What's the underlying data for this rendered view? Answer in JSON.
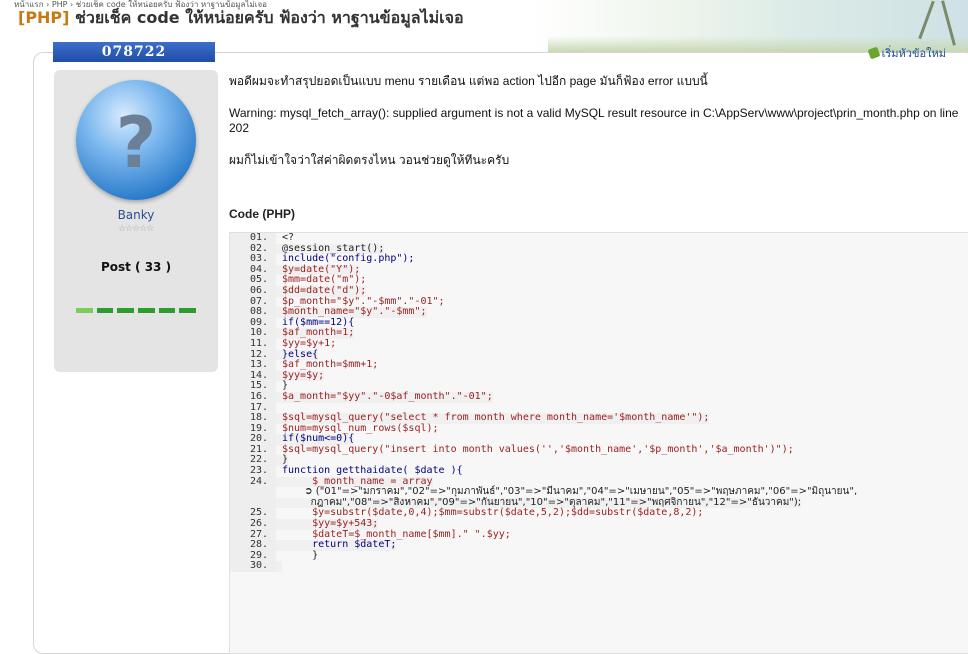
{
  "breadcrumb": "หน้าแรก › PHP › ช่วยเช็ค code ให้หน่อยครับ ฟ้องว่า หาฐานข้อมูลไม่เจอ",
  "topic": {
    "tag": "[PHP]",
    "title": "ช่วยเช็ค  code ให้หน่อยครับ  ฟ้องว่า  หาฐานข้อมูลไม่เจอ",
    "number": "078722",
    "new_topic_label": "เริ่มหัวข้อใหม่"
  },
  "user": {
    "name": "Banky",
    "stars": "☆☆☆☆☆",
    "post_count": "Post ( 33 )"
  },
  "post": {
    "paragraphs": [
      "พอดีผมจะทำสรุปยอดเป็นแบบ menu รายเดือน แต่พอ action ไปอีก page มันก็ฟ้อง error แบบนี้",
      "Warning: mysql_fetch_array(): supplied argument is not a valid MySQL result resource in C:\\AppServ\\www\\project\\prin_month.php on line 202",
      "ผมก็ไม่เข้าใจว่าใส่ค่าผิดตรงไหน วอนช่วยดูให้ทีนะครับ"
    ],
    "code_heading": "Code (PHP)",
    "code_lines": [
      {
        "n": "01.",
        "t": "<?"
      },
      {
        "n": "02.",
        "t": "@session_start();"
      },
      {
        "n": "03.",
        "t": "include(\"config.php\");"
      },
      {
        "n": "04.",
        "t": "$y=date(\"Y\");"
      },
      {
        "n": "05.",
        "t": "$mm=date(\"m\");"
      },
      {
        "n": "06.",
        "t": "$dd=date(\"d\");"
      },
      {
        "n": "07.",
        "t": "$p_month=\"$y\".\"-$mm\".\"-01\";"
      },
      {
        "n": "08.",
        "t": "$month_name=\"$y\".\"-$mm\";"
      },
      {
        "n": "09.",
        "t": "if($mm==12){"
      },
      {
        "n": "10.",
        "t": "$af_month=1;"
      },
      {
        "n": "11.",
        "t": "$yy=$y+1;"
      },
      {
        "n": "12.",
        "t": "}else{"
      },
      {
        "n": "13.",
        "t": "$af_month=$mm+1;"
      },
      {
        "n": "14.",
        "t": "$yy=$y;"
      },
      {
        "n": "15.",
        "t": "}"
      },
      {
        "n": "16.",
        "t": "$a_month=\"$yy\".\"-0$af_month\".\"-01\";"
      },
      {
        "n": "17.",
        "t": ""
      },
      {
        "n": "18.",
        "t": "$sql=mysql_query(\"select * from month where month_name='$month_name'\");"
      },
      {
        "n": "19.",
        "t": "$num=mysql_num_rows($sql);"
      },
      {
        "n": "20.",
        "t": "if($num<=0){"
      },
      {
        "n": "21.",
        "t": "$sql=mysql_query(\"insert into month values('','$month_name','$p_month','$a_month')\");"
      },
      {
        "n": "22.",
        "t": "}"
      },
      {
        "n": "23.",
        "t": "function getthaidate( $date ){"
      },
      {
        "n": "24.",
        "t": "     $_month_name = array"
      },
      {
        "n": "",
        "t": "       ➲ (\"01\"=>\"มกราคม\",\"02\"=>\"กุมภาพันธ์\",\"03\"=>\"มีนาคม\",\"04\"=>\"เมษายน\",\"05\"=>\"พฤษภาคม\",\"06\"=>\"มิถุนายน\","
      },
      {
        "n": "",
        "t": "         กฎาคม\",\"08\"=>\"สิงหาคม\",\"09\"=>\"กันยายน\",\"10\"=>\"ตุลาคม\",\"11\"=>\"พฤศจิกายน\",\"12\"=>\"ธันวาคม\");"
      },
      {
        "n": "25.",
        "t": "     $y=substr($date,0,4);$mm=substr($date,5,2);$dd=substr($date,8,2);"
      },
      {
        "n": "26.",
        "t": "     $yy=$y+543;"
      },
      {
        "n": "27.",
        "t": "     $dateT=$_month_name[$mm].\" \".$yy;"
      },
      {
        "n": "28.",
        "t": "     return $dateT;"
      },
      {
        "n": "29.",
        "t": "     }"
      },
      {
        "n": "30.",
        "t": ""
      }
    ]
  }
}
